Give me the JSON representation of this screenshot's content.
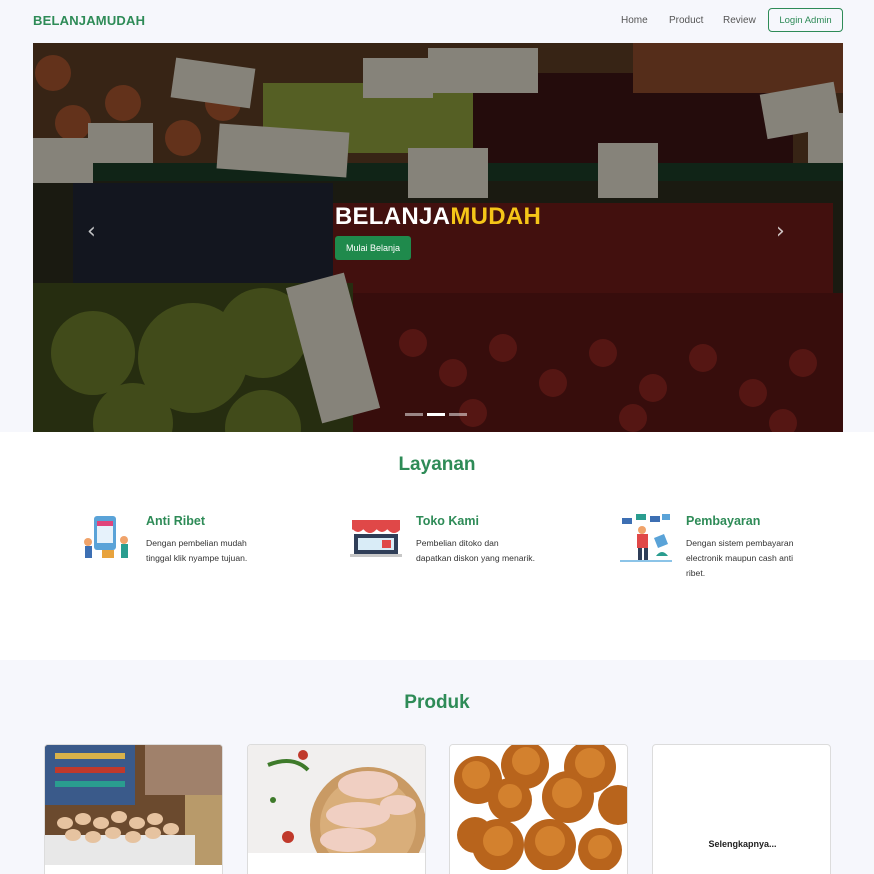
{
  "navbar": {
    "brand": "BELANJAMUDAH",
    "links": [
      "Home",
      "Product",
      "Review"
    ],
    "login_label": "Login Admin"
  },
  "hero": {
    "title_main": "BELANJA",
    "title_accent": "MUDAH",
    "cta_label": "Mulai Belanja",
    "prev_arrow": "‹",
    "next_arrow": "›",
    "slides_count": 3,
    "active_slide": 2
  },
  "services": {
    "title": "Layanan",
    "items": [
      {
        "title": "Anti Ribet",
        "description": "Dengan pembelian mudah tinggal klik nyampe tujuan.",
        "icon": "online-shop-illustration-icon"
      },
      {
        "title": "Toko Kami",
        "description": "Pembelian ditoko dan dapatkan diskon yang menarik.",
        "icon": "store-icon"
      },
      {
        "title": "Pembayaran",
        "description": "Dengan sistem pembayaran electronik maupun cash anti ribet.",
        "icon": "payment-illustration-icon"
      }
    ]
  },
  "products": {
    "title": "Produk",
    "items": [
      {
        "name": "eggs-product",
        "image": "eggs-image"
      },
      {
        "name": "chicken-product",
        "image": "chicken-drumsticks-image"
      },
      {
        "name": "palm-sugar-product",
        "image": "palm-sugar-image"
      }
    ],
    "more_label": "Selengkapnya..."
  },
  "colors": {
    "brand": "#2e8b57",
    "accent": "#f5c518",
    "cta": "#1f8a4c",
    "page_bg": "#f6f7fc"
  }
}
